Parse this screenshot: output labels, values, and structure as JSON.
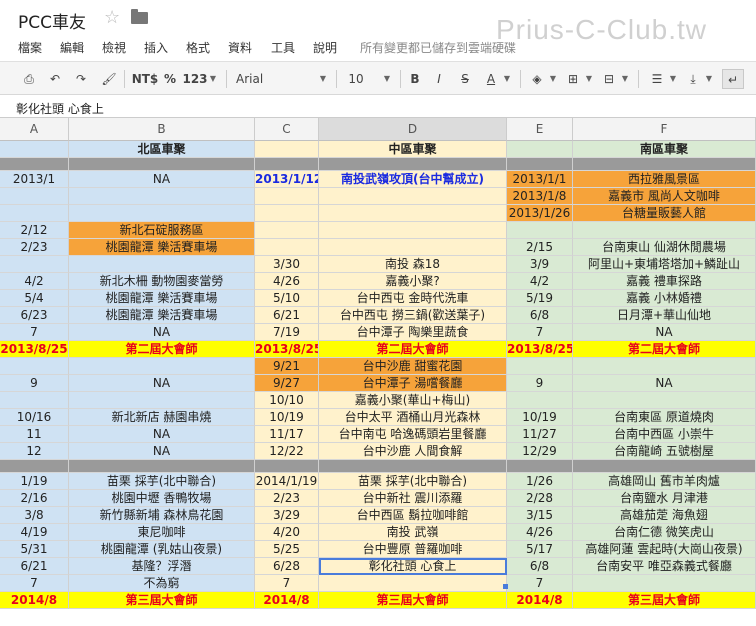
{
  "app": {
    "title": "PCC車友",
    "watermark": "Prius-C-Club.tw"
  },
  "menu": {
    "items": [
      "檔案",
      "編輯",
      "檢視",
      "插入",
      "格式",
      "資料",
      "工具",
      "說明"
    ],
    "save_status": "所有變更都已儲存到雲端硬碟"
  },
  "toolbar": {
    "currency": "NT$",
    "percent": "%",
    "number_format": "123",
    "font": "Arial",
    "font_size": "10",
    "bold": "B",
    "italic": "I",
    "strike": "S",
    "text_color": "A"
  },
  "formula": {
    "value": "彰化社頭 心食上"
  },
  "columns": [
    "A",
    "B",
    "C",
    "D",
    "E",
    "F"
  ],
  "colors": {
    "north": "#cfe2f3",
    "mid": "#fff2cc",
    "south": "#d9ead3",
    "orange": "#f6a33a",
    "highlight": "#ffff00",
    "highlight_text": "#e8001b",
    "separator": "#9a9a9a"
  },
  "rows": [
    {
      "t": "hdr",
      "a": "",
      "b": "北區車聚",
      "c": "",
      "d": "中區車聚",
      "e": "",
      "f": "南區車聚"
    },
    {
      "t": "sep"
    },
    {
      "t": "r",
      "a": "2013/1",
      "b": "NA",
      "c": "2013/1/12",
      "d": "南投武嶺攻頂(台中幫成立)",
      "e": "2013/1/1",
      "f": "西拉雅風景區",
      "cs": "bluebold",
      "ds": "bluebold",
      "es": "orange",
      "fs": "orange"
    },
    {
      "t": "r",
      "a": "",
      "b": "",
      "c": "",
      "d": "",
      "e": "2013/1/8",
      "f": "嘉義市 風尚人文咖啡",
      "es": "orange",
      "fs": "orange"
    },
    {
      "t": "r",
      "a": "",
      "b": "",
      "c": "",
      "d": "",
      "e": "2013/1/26",
      "f": "台糖量販藝人館",
      "es": "orange",
      "fs": "orange"
    },
    {
      "t": "r",
      "a": "2/12",
      "b": "新北石碇服務區",
      "c": "",
      "d": "",
      "e": "",
      "f": "",
      "bs": "orange"
    },
    {
      "t": "r",
      "a": "2/23",
      "b": "桃園龍潭 樂活賽車場",
      "c": "",
      "d": "",
      "e": "2/15",
      "f": "台南東山 仙湖休閒農場",
      "bs": "orange"
    },
    {
      "t": "r",
      "a": "",
      "b": "",
      "c": "3/30",
      "d": "南投 森18",
      "e": "3/9",
      "f": "阿里山+東埔塔塔加+鱗趾山"
    },
    {
      "t": "r",
      "a": "4/2",
      "b": "新北木柵 動物園麥當勞",
      "c": "4/26",
      "d": "嘉義小聚?",
      "e": "4/2",
      "f": "嘉義 禮車探路"
    },
    {
      "t": "r",
      "a": "5/4",
      "b": "桃園龍潭 樂活賽車場",
      "c": "5/10",
      "d": "台中西屯 金時代洗車",
      "e": "5/19",
      "f": "嘉義 小林婚禮"
    },
    {
      "t": "r",
      "a": "6/23",
      "b": "桃園龍潭 樂活賽車場",
      "c": "6/21",
      "d": "台中西屯 撈三鍋(歡送葉子)",
      "e": "6/8",
      "f": "日月潭+華山仙地"
    },
    {
      "t": "r",
      "a": "7",
      "b": "NA",
      "c": "7/19",
      "d": "台中潭子 陶樂里蔬食",
      "e": "7",
      "f": "NA"
    },
    {
      "t": "y",
      "a": "2013/8/25",
      "b": "第二屆大會師",
      "c": "2013/8/25",
      "d": "第二屆大會師",
      "e": "2013/8/25",
      "f": "第二屆大會師"
    },
    {
      "t": "r",
      "a": "",
      "b": "",
      "c": "9/21",
      "d": "台中沙鹿 甜蜜花園",
      "e": "",
      "f": "",
      "cs": "orange",
      "ds": "orange"
    },
    {
      "t": "r",
      "a": "9",
      "b": "NA",
      "c": "9/27",
      "d": "台中潭子 湯嚐餐廳",
      "e": "9",
      "f": "NA",
      "cs": "orange",
      "ds": "orange"
    },
    {
      "t": "r",
      "a": "",
      "b": "",
      "c": "10/10",
      "d": "嘉義小聚(華山+梅山)",
      "e": "",
      "f": ""
    },
    {
      "t": "r",
      "a": "10/16",
      "b": "新北新店 赫園串燒",
      "c": "10/19",
      "d": "台中太平 酒桶山月光森林",
      "e": "10/19",
      "f": "台南東區 原道燒肉"
    },
    {
      "t": "r",
      "a": "11",
      "b": "NA",
      "c": "11/17",
      "d": "台中南屯 哈逸碼頭岩里餐廳",
      "e": "11/27",
      "f": "台南中西區 小崇牛"
    },
    {
      "t": "r",
      "a": "12",
      "b": "NA",
      "c": "12/22",
      "d": "台中沙鹿 人間食解",
      "e": "12/29",
      "f": "台南龍崎 五號樹屋"
    },
    {
      "t": "sep"
    },
    {
      "t": "r",
      "a": "1/19",
      "b": "苗栗 採芋(北中聯合)",
      "c": "2014/1/19",
      "d": "苗栗 採芋(北中聯合)",
      "e": "1/26",
      "f": "高雄岡山 舊市羊肉爐"
    },
    {
      "t": "r",
      "a": "2/16",
      "b": "桃園中壢 香鴨牧場",
      "c": "2/23",
      "d": "台中新社 震川添羅",
      "e": "2/28",
      "f": "台南鹽水 月津港"
    },
    {
      "t": "r",
      "a": "3/8",
      "b": "新竹縣新埔 森林鳥花園",
      "c": "3/29",
      "d": "台中西區 鬍拉咖啡館",
      "e": "3/15",
      "f": "高雄茄萣 海魚翅"
    },
    {
      "t": "r",
      "a": "4/19",
      "b": "東尼咖啡",
      "c": "4/20",
      "d": "南投 武嶺",
      "e": "4/26",
      "f": "台南仁德 微笑虎山"
    },
    {
      "t": "r",
      "a": "5/31",
      "b": "桃園龍潭 (乳姑山夜景)",
      "c": "5/25",
      "d": "台中豐原 普羅咖啡",
      "e": "5/17",
      "f": "高雄阿蓮 雲起時(大崗山夜景)"
    },
    {
      "t": "r",
      "a": "6/21",
      "b": "基隆？浮潛",
      "c": "6/28",
      "d": "彰化社頭 心食上",
      "e": "6/8",
      "f": "台南安平 唯亞森義式餐廳",
      "dsel": true
    },
    {
      "t": "r",
      "a": "7",
      "b": "不為窮",
      "c": "7",
      "d": "",
      "e": "7",
      "f": ""
    },
    {
      "t": "y",
      "a": "2014/8",
      "b": "第三屆大會師",
      "c": "2014/8",
      "d": "第三屆大會師",
      "e": "2014/8",
      "f": "第三屆大會師"
    }
  ]
}
